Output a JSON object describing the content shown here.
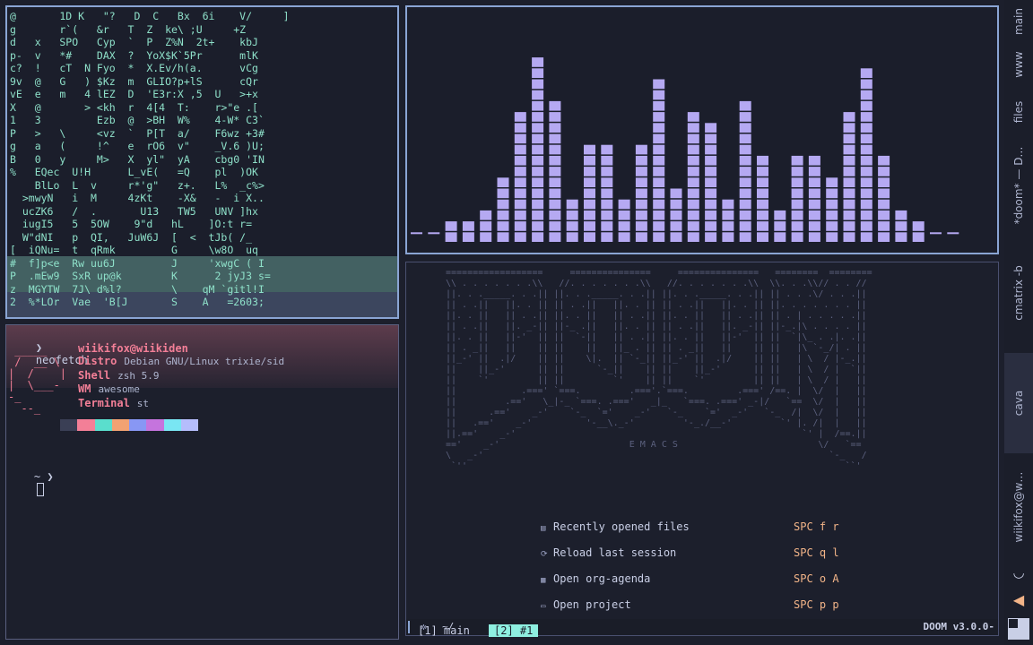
{
  "matrix": {
    "lines": [
      "@       1D K   \"?   D  C   Bx  6i    V/     ]",
      "g       r`(   &r   T  Z  ke\\ ;U     +Z",
      "d   x   SPO   Cyp  `  P  Z%N  2t+    kbJ",
      "p-  v   *#    DAX  ?  YoX$K`5Pr      mlK",
      "c?  !   cT  N Fyo  *  X.Ev/h(a.      vCg",
      "9v  @   G   ) $Kz  m  GLIO?p+lS      cQr",
      "vE  e   m   4 lEZ  D  'E3r:X ,5  U   >+x",
      "X   @       > <kh  r  4[4  T:    r>\"e .[",
      "1   3         Ezb  @  >BH  W%    4-W* C3`",
      "P   >   \\     <vz  `  P[T  a/    F6wz +3#",
      "g   a   (     !^   e  rO6  v\"    _V.6 )U;",
      "B   0   y     M>   X  yl\"  yA    cbg0 'IN",
      "%   EQec  U!H      L_vE(   =Q    pl  )OK",
      "    BlLo  L  v     r*'g\"   z+.   L%  _c%>",
      "  >mwyN   i  M     4zKt    -X&   -  i X..",
      "  ucZK6   /  .       U13   TW5   UNV ]hx",
      "  iugI5   5  5OW    9\"d   hL    ]O:t r=",
      "  W\"dNI   p  QI,   JuW6J  [  <  tJb( /_",
      "[  iQNu=  t  qRmk         G     \\w8O  uq",
      "#  f]p<e  Rw uu6J         J     'xwgC ( I",
      "P  .mEw9  SxR up@k        K      2 jyJ3 s=",
      "z  MGYTW  7J\\ d%l?        \\    qM `gitl!I",
      "2  %*LOr  Vae  'B[J       S    A   =2603;"
    ],
    "band_colors": [
      "#8ee0c9",
      "#8aa5d4"
    ]
  },
  "cava": {
    "bar_levels": [
      1,
      1,
      2,
      2,
      3,
      6,
      12,
      17,
      13,
      4,
      9,
      9,
      4,
      9,
      15,
      5,
      12,
      11,
      4,
      13,
      8,
      3,
      8,
      8,
      6,
      12,
      16,
      8,
      3,
      2,
      1,
      1
    ],
    "bar_color": "#b5a9f2"
  },
  "terminal": {
    "prompt_symbol": "❯",
    "command": "neofetch",
    "user_host": "wiikifox@wiikiden",
    "info": [
      {
        "key": "Distro",
        "value": "Debian GNU/Linux trixie/sid"
      },
      {
        "key": "Shell",
        "value": "zsh 5.9"
      },
      {
        "key": "WM",
        "value": "awesome"
      },
      {
        "key": "Terminal",
        "value": "st"
      }
    ],
    "logo": " _____\n /  __ \\\n|  /    |\n|  \\___-\n-_\n  --_",
    "palette": [
      "#3a3f55",
      "#f37f97",
      "#5adecd",
      "#f2a272",
      "#8897f4",
      "#c574dd",
      "#79e6f3",
      "#b5bdfc"
    ],
    "prompt2": "~ ❯"
  },
  "doom": {
    "art": "==================     ===============     ===============   ========  ========\n\\\\ . . . . . . .\\\\   //. . . . . . .\\\\   //. . . . . . .\\\\  \\\\. . .\\\\// . . //\n||. . ._____. . .|| ||. . ._____. . .|| ||. . ._____. . .|| || . . .\\/ . . .||\n|| . .||   ||. . || || . .||   ||. . || || . .||   ||. . || ||. . . . . . . ||\n||. . ||   || . .|| ||. . ||   || . .|| ||. . ||   || . .|| || . | . . . . .||\n|| . .||   ||. _-|| ||-_ .||   ||. . || || . .||   ||. _-|| ||-_.|\\ . . . . ||\n||. . ||   ||-'  || ||  `-||   || . .|| ||. . ||   ||-'  || ||  `|\\_ . .|. .||\n|| . _||   ||    || ||    ||   ||_ . || || . _||   ||    || ||   |\\ `-_/| . ||\n||_-' ||  .|/    || ||    \\|.  || `-_|| ||_-' ||  .|/    || ||   | \\  / |-_.||\n||    ||_-'      || ||      `-_||    || ||    ||_-'      || ||   | \\  / |  `||\n||    `'         || ||         `'    || ||    `'         || ||   | \\  / |   ||\n||            .===' `===.         .==='.`===.         .===' /==. |  \\/  |   ||\n||         .=='   \\_|-_ `===. .==='   _|_   `===. .===' _-|/   `==  \\/  |   ||\n||      .=='    _-'    `-_  `='    _-'   `-_    `='  _-'   `-_  /|  \\/  |   ||\n||   .=='    _-'          '-__\\._-'         '-_./__-'         `' |. /|  |   ||\n||.=='    _-'                                                     `' |  /==.||\n=='    _-'                        E M A C S                          \\/   `==\n\\   _-'                                                                `-_   /\n `''                                                                      ``'",
    "menu": [
      {
        "icon": "file-icon",
        "glyph": "▤",
        "label": "Recently opened files",
        "key": "SPC f r"
      },
      {
        "icon": "reload-icon",
        "glyph": "⟳",
        "label": "Reload last session",
        "key": "SPC q l"
      },
      {
        "icon": "calendar-icon",
        "glyph": "▦",
        "label": "Open org-agenda",
        "key": "SPC o A"
      },
      {
        "icon": "folder-icon",
        "glyph": "▭",
        "label": "Open project",
        "key": "SPC p p"
      }
    ],
    "modeline_path": "~/",
    "modeline_version": "DOOM v3.0.0-"
  },
  "tmux": {
    "window1": "[1] main",
    "window2": "[2] #1"
  },
  "sidebar": {
    "tags": [
      "main",
      "www",
      "files",
      "*doom* — D…",
      "cmatrix -b",
      "cava",
      "wiikifox@w…"
    ],
    "active_tag": 5
  }
}
